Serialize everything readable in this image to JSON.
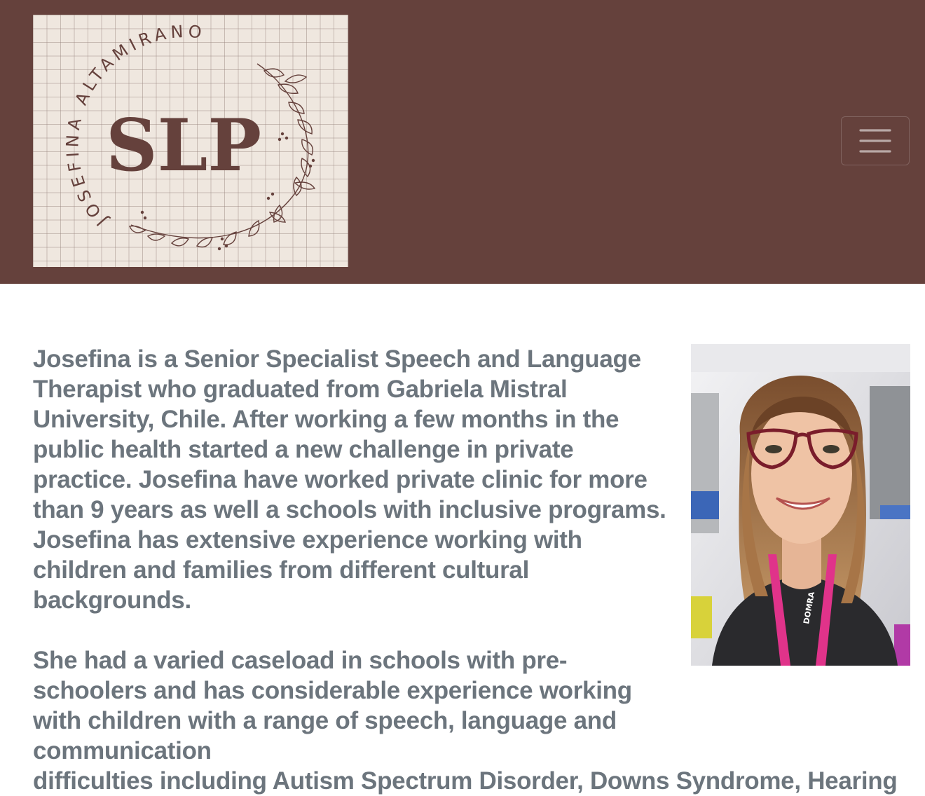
{
  "header": {
    "brand": {
      "logo_arc_text": "JOSEFINA ALTAMIRANO",
      "logo_main_text": "SLP",
      "colors": {
        "background": "#efe7df",
        "ink": "#65413c"
      }
    },
    "menu_toggle_icon": "hamburger-icon",
    "background_color": "#65413c"
  },
  "about": {
    "paragraph_1": "Josefina is a Senior Specialist Speech and Language Therapist who graduated from Gabriela Mistral University, Chile. After working a few months in the public health started a new challenge in private practice. Josefina have worked private clinic for more than 9 years as well a schools with inclusive programs. Josefina has extensive experience working with children and families from different cultural backgrounds.",
    "paragraph_2_narrow": "She had a varied caseload in schools with pre-schoolers and has considerable experience working with children with a range of speech, language and communication",
    "paragraph_2_wide": "difficulties including Autism Spectrum Disorder, Downs Syndrome, Hearing",
    "portrait": {
      "lanyard_text": "DOMRA",
      "text_color": "#6c757d"
    }
  }
}
